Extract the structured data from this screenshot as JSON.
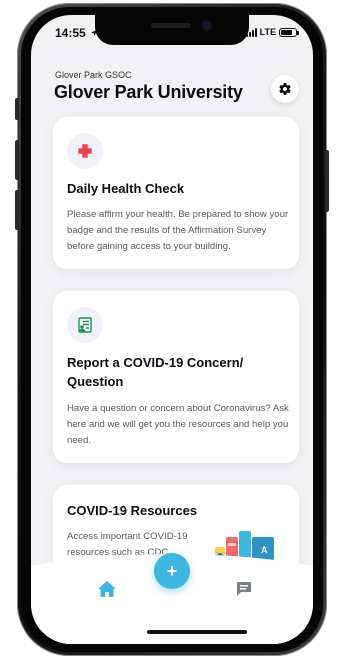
{
  "status_bar": {
    "time": "14:55",
    "network": "LTE",
    "battery_level": 0.8
  },
  "header": {
    "subtitle": "Glover Park GSOC",
    "title": "Glover Park University",
    "settings_icon": "gear-icon"
  },
  "cards": [
    {
      "icon": "medical-cross-icon",
      "title": "Daily Health Check",
      "description": "Please affirm your health.  Be prepared to show your badge and the results of the Affirmation Survey before gaining access to your building."
    },
    {
      "icon": "report-document-icon",
      "title": "Report a COVID-19 Concern/ Question",
      "description": "Have a question or concern about Coronavirus? Ask here and we will get you the resources and help you need."
    },
    {
      "icon": "books-illustration",
      "title": "COVID-19 Resources",
      "description": "Access important COVID-19 resources such as CDC"
    }
  ],
  "bottom_nav": {
    "home_icon": "home-icon",
    "add_label": "+",
    "chat_icon": "chat-icon"
  },
  "colors": {
    "accent": "#3fb6e0",
    "health_icon": "#e8474f",
    "report_icon": "#1c8f5c",
    "background": "#f2f2f4"
  }
}
